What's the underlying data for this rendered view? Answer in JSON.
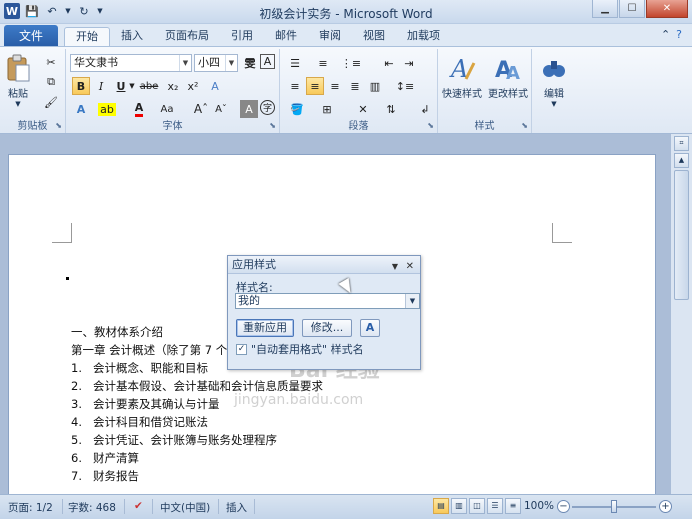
{
  "window": {
    "title": "初级会计实务 - Microsoft Word"
  },
  "file_tab": "文件",
  "tabs": [
    "开始",
    "插入",
    "页面布局",
    "引用",
    "邮件",
    "审阅",
    "视图",
    "加载项"
  ],
  "ribbon": {
    "clipboard": {
      "paste": "粘贴",
      "group": "剪贴板"
    },
    "font": {
      "name": "华文隶书",
      "size": "小四",
      "group": "字体"
    },
    "paragraph": {
      "group": "段落"
    },
    "styles": {
      "quick": "快速样式",
      "change": "更改样式",
      "group": "样式"
    },
    "editing": {
      "label": "编辑"
    }
  },
  "dialog": {
    "title": "应用样式",
    "label": "样式名:",
    "value": "我的",
    "reapply": "重新应用",
    "modify": "修改...",
    "checkbox_label": "\"自动套用格式\" 样式名",
    "checkbox_checked": true
  },
  "document": {
    "heading": "一、教材体系介绍",
    "chapter": "第一章  会计概述（除了第 7 个）",
    "items": [
      {
        "num": "1.",
        "text": "会计概念、职能和目标"
      },
      {
        "num": "2.",
        "text": "会计基本假设、会计基础和会计信息质量要求"
      },
      {
        "num": "3.",
        "text": "会计要素及其确认与计量"
      },
      {
        "num": "4.",
        "text": "会计科目和借贷记账法"
      },
      {
        "num": "5.",
        "text": "会计凭证、会计账簿与账务处理程序"
      },
      {
        "num": "6.",
        "text": "财产清算"
      },
      {
        "num": "7.",
        "text": "财务报告"
      }
    ],
    "watermark": "Bai 经验",
    "watermark_url": "jingyan.baidu.com"
  },
  "status": {
    "page": "页面: 1/2",
    "words": "字数: 468",
    "language": "中文(中国)",
    "mode": "插入",
    "zoom": "100%",
    "zoom_level": 100
  }
}
